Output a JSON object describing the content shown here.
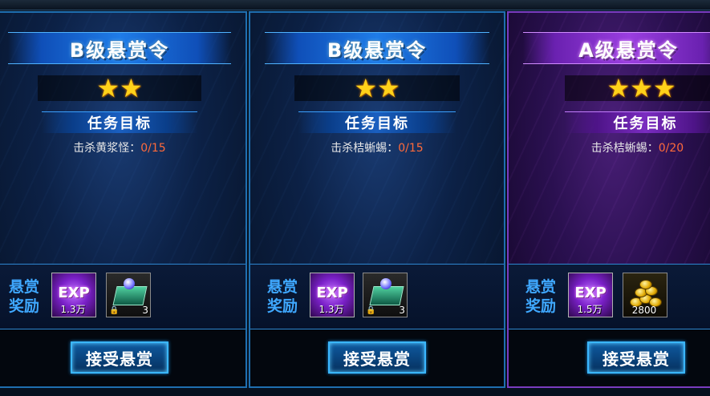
{
  "cards": [
    {
      "theme": "blue",
      "title": "B级悬赏令",
      "stars": "★★",
      "task_label": "任务目标",
      "kill_target": "击杀黄浆怪：",
      "progress": "0/15",
      "reward_label": "悬赏奖励",
      "rewards": [
        {
          "icon": "exp-icon",
          "label": "EXP",
          "qty": "1.3万"
        },
        {
          "icon": "chest-icon",
          "qty": "3"
        }
      ],
      "accept": "接受悬赏"
    },
    {
      "theme": "blue",
      "title": "B级悬赏令",
      "stars": "★★",
      "task_label": "任务目标",
      "kill_target": "击杀桔蜥蜴：",
      "progress": "0/15",
      "reward_label": "悬赏奖励",
      "rewards": [
        {
          "icon": "exp-icon",
          "label": "EXP",
          "qty": "1.3万"
        },
        {
          "icon": "chest-icon",
          "qty": "3"
        }
      ],
      "accept": "接受悬赏"
    },
    {
      "theme": "purple",
      "title": "A级悬赏令",
      "stars": "★★★",
      "task_label": "任务目标",
      "kill_target": "击杀桔蜥蜴：",
      "progress": "0/20",
      "reward_label": "悬赏奖励",
      "rewards": [
        {
          "icon": "exp-icon",
          "label": "EXP",
          "qty": "1.5万"
        },
        {
          "icon": "gold-coins-icon",
          "qty": "2800"
        }
      ],
      "accept": "接受悬赏"
    }
  ],
  "colors": {
    "blue_border": "#1f6fb0",
    "purple_border": "#7a3cc0",
    "star": "#ffd21a",
    "progress": "#ff6a3a",
    "reward_label": "#3fa8ff"
  }
}
